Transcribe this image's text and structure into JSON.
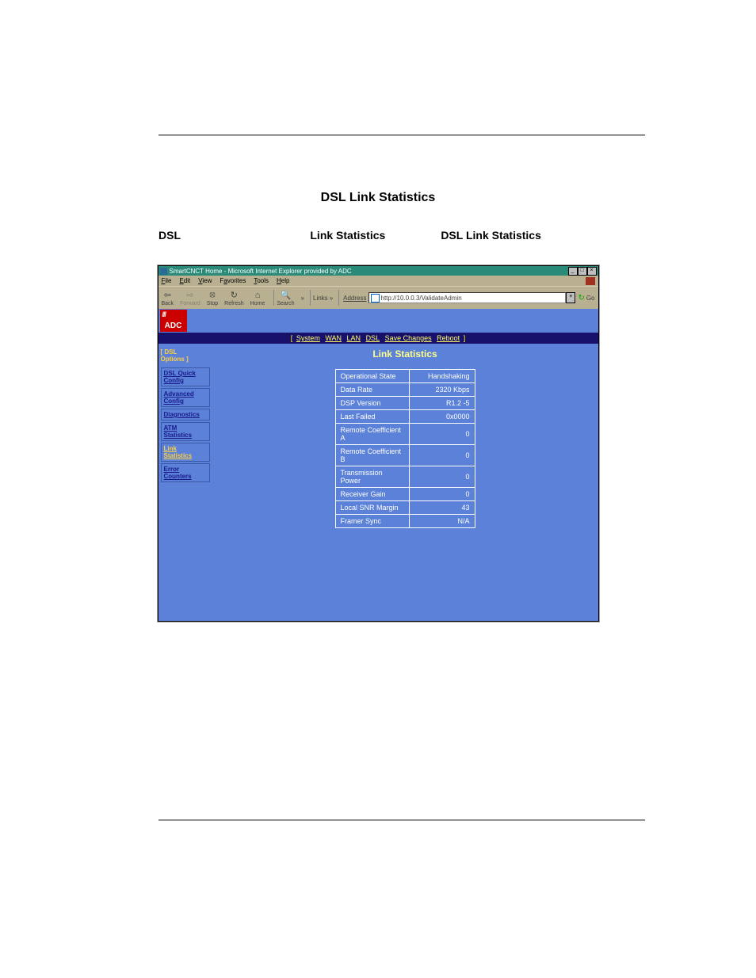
{
  "section_title": "DSL Link Statistics",
  "intro": {
    "w1": "DSL",
    "w2": "Link Statistics",
    "w3": "DSL Link Statistics"
  },
  "browser": {
    "title": "SmartCNCT Home - Microsoft Internet Explorer provided by ADC",
    "menus": {
      "file": "File",
      "edit": "Edit",
      "view": "View",
      "favorites": "Favorites",
      "tools": "Tools",
      "help": "Help"
    },
    "tb": {
      "back": "Back",
      "forward": "Forward",
      "stop": "Stop",
      "refresh": "Refresh",
      "home": "Home",
      "search": "Search"
    },
    "links_label": "Links",
    "address_label": "Address",
    "address_value": "http://10.0.0.3/ValidateAdmin",
    "go": "Go"
  },
  "logo": "ADC",
  "topnav": {
    "lb": "[",
    "rb": "]",
    "items": [
      "System",
      "WAN",
      "LAN",
      "DSL",
      "Save Changes",
      "Reboot"
    ]
  },
  "sidebar": {
    "head_l": "[ DSL",
    "head_r": "Options ]",
    "items": [
      {
        "label": "DSL Quick Config",
        "active": false
      },
      {
        "label": "Advanced Config",
        "active": false
      },
      {
        "label": "Diagnostics",
        "active": false
      },
      {
        "label": "ATM Statistics",
        "active": false
      },
      {
        "label": "Link Statistics",
        "active": true
      },
      {
        "label": "Error Counters",
        "active": false
      }
    ]
  },
  "page_heading": "Link Statistics",
  "stats": [
    {
      "k": "Operational State",
      "v": "Handshaking"
    },
    {
      "k": "Data Rate",
      "v": "2320 Kbps"
    },
    {
      "k": "DSP Version",
      "v": "R1.2 -5"
    },
    {
      "k": "Last Failed",
      "v": "0x0000"
    },
    {
      "k": "Remote Coefficient A",
      "v": "0"
    },
    {
      "k": "Remote Coefficient B",
      "v": "0"
    },
    {
      "k": "Transmission Power",
      "v": "0"
    },
    {
      "k": "Receiver Gain",
      "v": "0"
    },
    {
      "k": "Local SNR Margin",
      "v": "43"
    },
    {
      "k": "Framer Sync",
      "v": "N/A"
    }
  ]
}
